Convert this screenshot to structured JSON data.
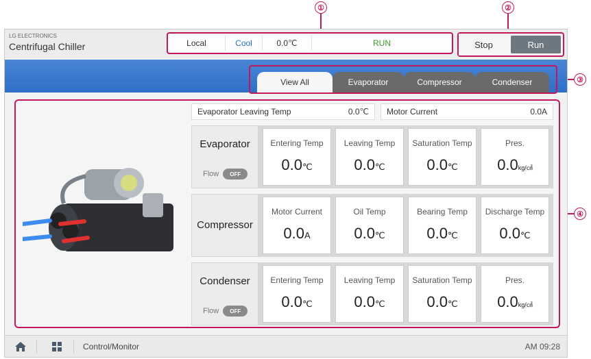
{
  "brand": {
    "company": "LG ELECTRONICS",
    "title": "Centrifugal Chiller"
  },
  "status": {
    "mode": "Local",
    "operation": "Cool",
    "temp": "0.0℃",
    "state": "RUN"
  },
  "controls": {
    "stop": "Stop",
    "run": "Run"
  },
  "tabs": [
    "View All",
    "Evaporator",
    "Compressor",
    "Condenser"
  ],
  "callouts": [
    "①",
    "②",
    "③",
    "④"
  ],
  "summary": {
    "evap_leaving_label": "Evaporator Leaving Temp",
    "evap_leaving_value": "0.0℃",
    "motor_current_label": "Motor Current",
    "motor_current_value": "0.0A"
  },
  "evaporator": {
    "name": "Evaporator",
    "flow_label": "Flow",
    "flow_state": "OFF",
    "cells": [
      {
        "label": "Entering Temp",
        "value": "0.0",
        "unit": "℃"
      },
      {
        "label": "Leaving Temp",
        "value": "0.0",
        "unit": "℃"
      },
      {
        "label": "Saturation Temp",
        "value": "0.0",
        "unit": "℃"
      },
      {
        "label": "Pres.",
        "value": "0.0",
        "unit": "kg/㎠"
      }
    ]
  },
  "compressor": {
    "name": "Compressor",
    "cells": [
      {
        "label": "Motor Current",
        "value": "0.0",
        "unit": "A"
      },
      {
        "label": "Oil Temp",
        "value": "0.0",
        "unit": "℃"
      },
      {
        "label": "Bearing Temp",
        "value": "0.0",
        "unit": "℃"
      },
      {
        "label": "Discharge Temp",
        "value": "0.0",
        "unit": "℃"
      }
    ]
  },
  "condenser": {
    "name": "Condenser",
    "flow_label": "Flow",
    "flow_state": "OFF",
    "cells": [
      {
        "label": "Entering Temp",
        "value": "0.0",
        "unit": "℃"
      },
      {
        "label": "Leaving Temp",
        "value": "0.0",
        "unit": "℃"
      },
      {
        "label": "Saturation Temp",
        "value": "0.0",
        "unit": "℃"
      },
      {
        "label": "Pres.",
        "value": "0.0",
        "unit": "kg/㎠"
      }
    ]
  },
  "footer": {
    "page": "Control/Monitor",
    "time": "AM 09:28"
  },
  "colors": {
    "accent": "#c2185b",
    "header_blue": "#3a78cf",
    "run_green": "#3a9a2a",
    "cool_blue": "#2a6fd0"
  }
}
